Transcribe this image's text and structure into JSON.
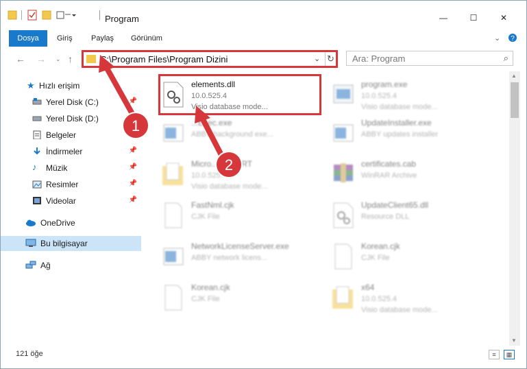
{
  "window": {
    "title": "Program",
    "controls": {
      "minimize": "—",
      "maximize": "☐",
      "close": "✕"
    }
  },
  "ribbon": {
    "tabs": [
      "Dosya",
      "Giriş",
      "Paylaş",
      "Görünüm"
    ],
    "expand_icon": "chevron-down-icon",
    "help_icon": "help-icon"
  },
  "address_bar": {
    "path": "C:\\Program Files\\Program Dizini",
    "refresh": "↻"
  },
  "search": {
    "placeholder": "Ara: Program"
  },
  "nav_pane": {
    "items": [
      {
        "label": "Hızlı erişim",
        "icon": "star-icon",
        "pinned": false
      },
      {
        "label": "Yerel Disk (C:)",
        "icon": "drive-icon",
        "pinned": true
      },
      {
        "label": "Yerel Disk (D:)",
        "icon": "drive-icon",
        "pinned": true
      },
      {
        "label": "Belgeler",
        "icon": "documents-icon",
        "pinned": true
      },
      {
        "label": "İndirmeler",
        "icon": "download-icon",
        "pinned": true
      },
      {
        "label": "Müzik",
        "icon": "music-icon",
        "pinned": true
      },
      {
        "label": "Resimler",
        "icon": "pictures-icon",
        "pinned": true
      },
      {
        "label": "Videolar",
        "icon": "videos-icon",
        "pinned": true
      },
      {
        "label": "OneDrive",
        "icon": "cloud-icon",
        "pinned": false
      },
      {
        "label": "Bu bilgisayar",
        "icon": "computer-icon",
        "pinned": false,
        "selected": true
      },
      {
        "label": "Ağ",
        "icon": "network-icon",
        "pinned": false
      }
    ]
  },
  "files": [
    {
      "name": "elements.dll",
      "line2": "10.0.525.4",
      "line3": "Visio database mode...",
      "icon": "dll-gear-icon",
      "highlighted": true
    },
    {
      "name": "program.exe",
      "line2": "10.0.525.4",
      "line3": "Visio database mode...",
      "icon": "exe-icon",
      "highlighted": false
    },
    {
      "name": "...Exec.exe",
      "line2": "ABBY background exe...",
      "line3": "",
      "icon": "exe-window-icon",
      "highlighted": false
    },
    {
      "name": "UpdateInstaller.exe",
      "line2": "ABBY updates installer",
      "line3": "",
      "icon": "exe-window-icon",
      "highlighted": false
    },
    {
      "name": "Micro...C90 CRT",
      "line2": "10.0.525...",
      "line3": "Visio database mode...",
      "icon": "folder-doc-icon",
      "highlighted": false
    },
    {
      "name": "certificates.cab",
      "line2": "WinRAR Archive",
      "line3": "",
      "icon": "winrar-icon",
      "highlighted": false
    },
    {
      "name": "FastNml.cjk",
      "line2": "CJK File",
      "line3": "",
      "icon": "blank-file-icon",
      "highlighted": false
    },
    {
      "name": "UpdateClient65.dll",
      "line2": "Resource DLL",
      "line3": "",
      "icon": "dll-gear-icon",
      "highlighted": false
    },
    {
      "name": "NetworkLicenseServer.exe",
      "line2": "ABBY network licens...",
      "line3": "",
      "icon": "exe-window-icon",
      "highlighted": false
    },
    {
      "name": "Korean.cjk",
      "line2": "CJK File",
      "line3": "",
      "icon": "blank-file-icon",
      "highlighted": false
    },
    {
      "name": "Korean.cjk",
      "line2": "CJK File",
      "line3": "",
      "icon": "blank-file-icon",
      "highlighted": false
    },
    {
      "name": "x64",
      "line2": "10.0.525.4",
      "line3": "Visio database mode...",
      "icon": "folder-doc-icon",
      "highlighted": false
    }
  ],
  "status": {
    "count": "121 öğe"
  },
  "annotations": [
    {
      "number": "1",
      "color": "#d5373a"
    },
    {
      "number": "2",
      "color": "#d5373a"
    }
  ]
}
